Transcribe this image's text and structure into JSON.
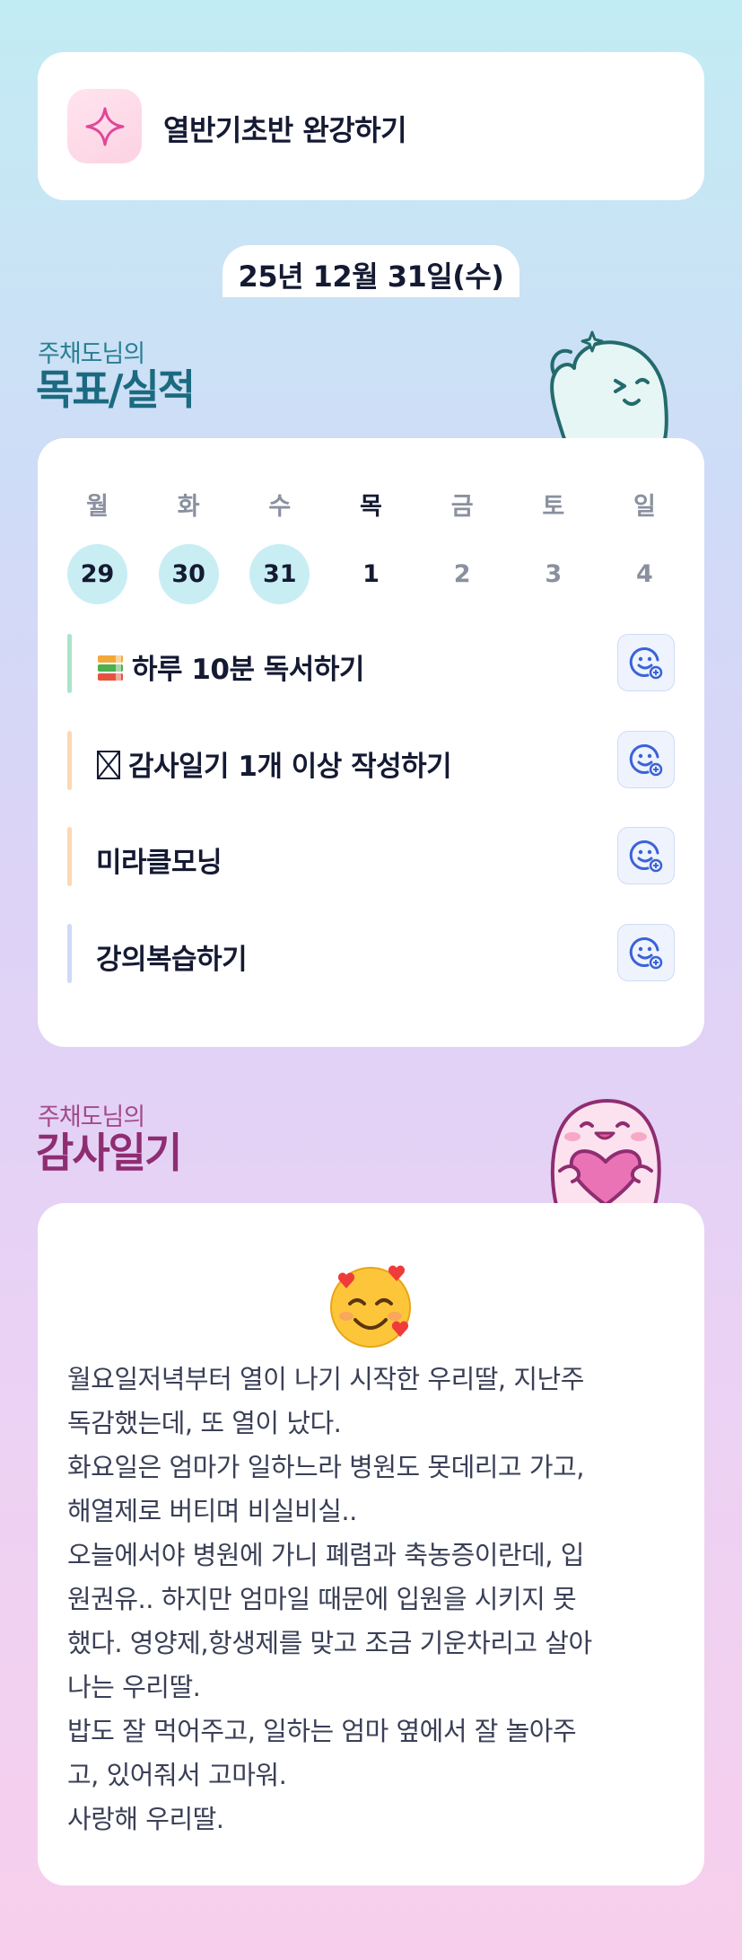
{
  "goal": {
    "icon": "sparkle-icon",
    "title": "열반기초반 완강하기"
  },
  "date_label": "25년 12월 31일(수)",
  "goals_section": {
    "subtitle": "주채도님의",
    "title": "목표/실적"
  },
  "week": {
    "days": [
      {
        "weekday": "월",
        "date": "29",
        "state": "past"
      },
      {
        "weekday": "화",
        "date": "30",
        "state": "past"
      },
      {
        "weekday": "수",
        "date": "31",
        "state": "past"
      },
      {
        "weekday": "목",
        "date": "1",
        "state": "today"
      },
      {
        "weekday": "금",
        "date": "2",
        "state": "future"
      },
      {
        "weekday": "토",
        "date": "3",
        "state": "future"
      },
      {
        "weekday": "일",
        "date": "4",
        "state": "future"
      }
    ]
  },
  "tasks": [
    {
      "label": "하루 10분 독서하기",
      "icon": "books-icon",
      "accent": "#a8e6c9",
      "action_icon": "smiley-plus-icon"
    },
    {
      "label": "감사일기 1개 이상 작성하기",
      "icon": "missing-glyph-icon",
      "accent": "#fcd8b4",
      "action_icon": "smiley-plus-icon"
    },
    {
      "label": "미라클모닝",
      "icon": "",
      "accent": "#fcd8b4",
      "action_icon": "smiley-plus-icon"
    },
    {
      "label": "강의복습하기",
      "icon": "",
      "accent": "#cfdaf8",
      "action_icon": "smiley-plus-icon"
    }
  ],
  "diary_section": {
    "subtitle": "주채도님의",
    "title": "감사일기"
  },
  "diary": {
    "emoji": "smiling-face-with-hearts-icon",
    "lines": [
      "월요일저녁부터 열이 나기 시작한 우리딸, 지난주",
      "독감했는데, 또 열이 났다.",
      "화요일은 엄마가 일하느라 병원도 못데리고 가고,",
      "해열제로 버티며 비실비실..",
      "오늘에서야 병원에 가니 폐렴과 축농증이란데, 입",
      "원권유.. 하지만 엄마일 때문에 입원을 시키지 못",
      "했다. 영양제,항생제를 맞고 조금 기운차리고 살아",
      "나는 우리딸.",
      "밥도 잘 먹어주고, 일하는 엄마 옆에서 잘 놀아주",
      "고, 있어줘서 고마워.",
      "사랑해 우리딸."
    ]
  },
  "colors": {
    "goal_section": "#1b6a80",
    "diary_section": "#8f2d72",
    "past_day_bg": "#c8eef4",
    "action_icon": "#3a63d8"
  }
}
